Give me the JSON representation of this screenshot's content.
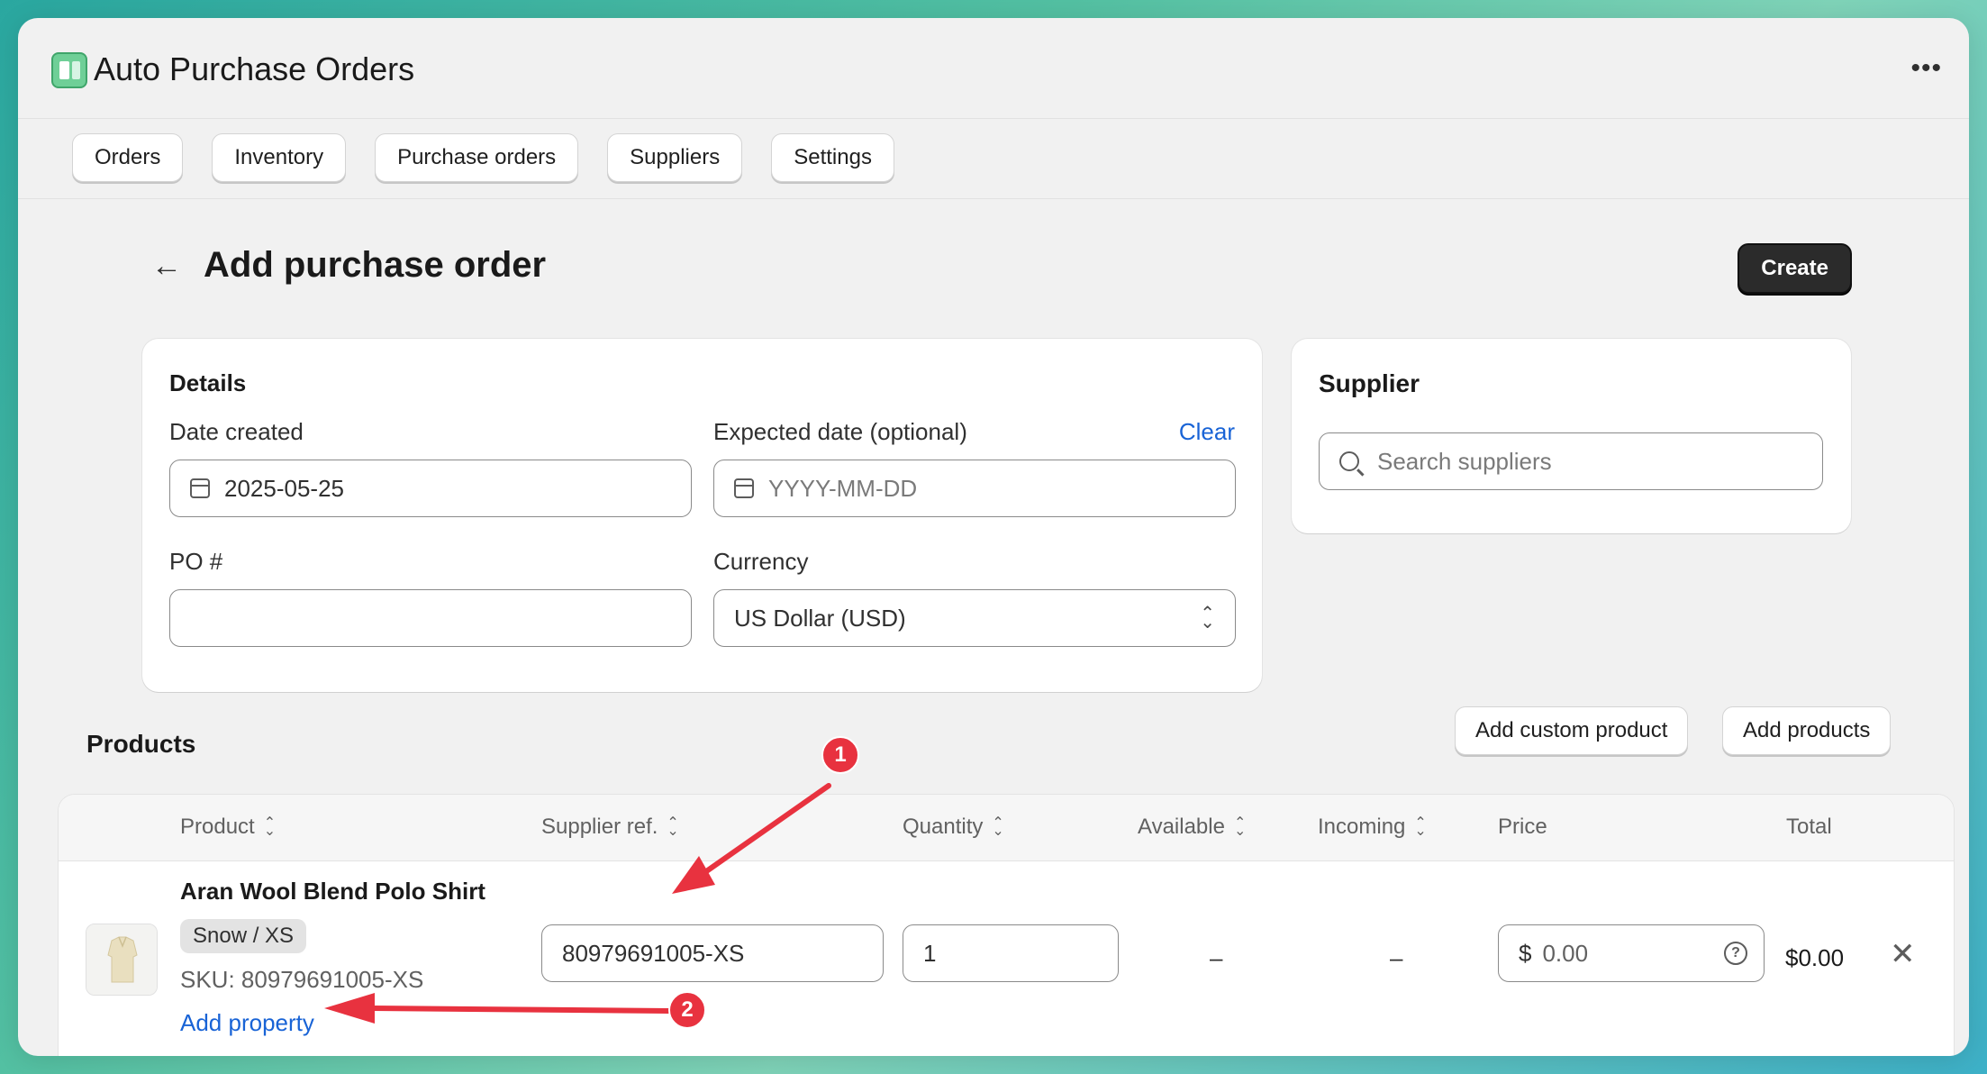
{
  "app": {
    "title": "Auto Purchase Orders",
    "more_icon": "more-horizontal-icon"
  },
  "tabs": [
    "Orders",
    "Inventory",
    "Purchase orders",
    "Suppliers",
    "Settings"
  ],
  "page": {
    "title": "Add purchase order",
    "create_label": "Create"
  },
  "details": {
    "heading": "Details",
    "date_created_label": "Date created",
    "date_created_value": "2025-05-25",
    "expected_label": "Expected date (optional)",
    "expected_placeholder": "YYYY-MM-DD",
    "clear_label": "Clear",
    "po_label": "PO #",
    "po_value": "",
    "currency_label": "Currency",
    "currency_value": "US Dollar (USD)"
  },
  "supplier": {
    "heading": "Supplier",
    "search_placeholder": "Search suppliers"
  },
  "products": {
    "heading": "Products",
    "add_custom_label": "Add custom product",
    "add_products_label": "Add products",
    "columns": [
      "Product",
      "Supplier ref.",
      "Quantity",
      "Available",
      "Incoming",
      "Price",
      "Total"
    ],
    "rows": [
      {
        "name": "Aran Wool Blend Polo Shirt",
        "variant": "Snow / XS",
        "sku": "SKU: 80979691005-XS",
        "add_property": "Add property",
        "supplier_ref": "80979691005-XS",
        "quantity": "1",
        "available": "–",
        "incoming": "–",
        "price_currency": "$",
        "price": "0.00",
        "total": "$0.00"
      }
    ]
  },
  "annotations": {
    "marker_1": "1",
    "marker_2": "2",
    "color": "#e8323f"
  }
}
